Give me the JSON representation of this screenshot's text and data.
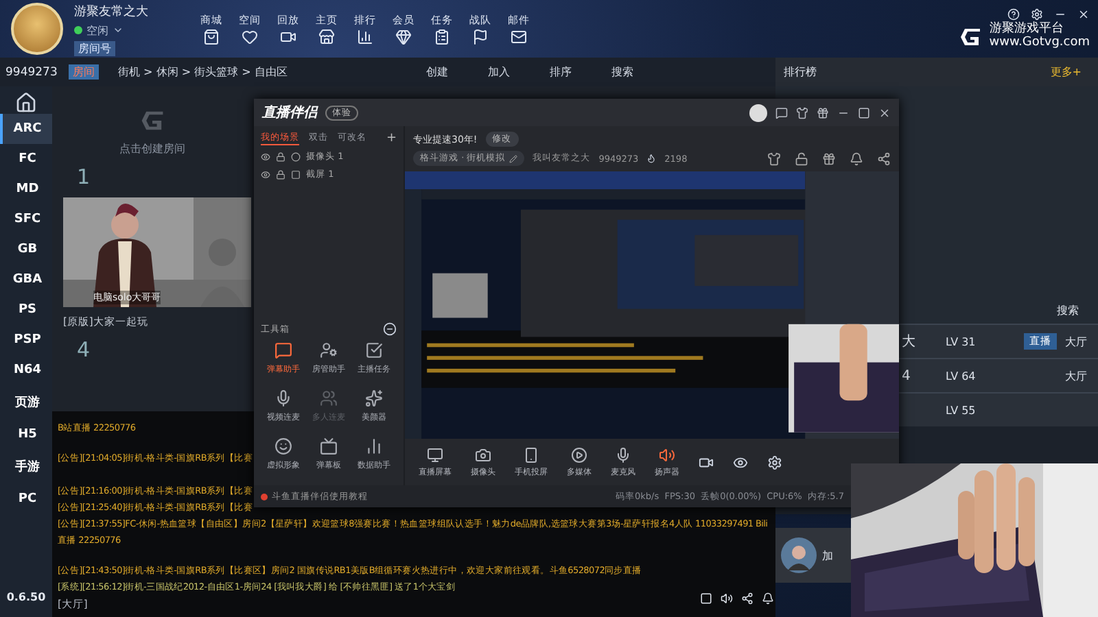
{
  "user": {
    "name": "游聚友常之大",
    "status": "空闲",
    "room_label": "房间号",
    "room_id": "9949273",
    "room_tag": "房间"
  },
  "nav": [
    {
      "label": "商城"
    },
    {
      "label": "空间"
    },
    {
      "label": "回放"
    },
    {
      "label": "主页"
    },
    {
      "label": "排行"
    },
    {
      "label": "会员"
    },
    {
      "label": "任务"
    },
    {
      "label": "战队"
    },
    {
      "label": "邮件"
    }
  ],
  "brand": {
    "name": "游聚游戏平台",
    "url": "www.Gotvg.com"
  },
  "breadcrumb": "街机 > 休闲 > 街头篮球 > 自由区",
  "room_actions": [
    "创建",
    "加入",
    "排序",
    "搜索"
  ],
  "platforms": [
    {
      "label": "ARC",
      "selected": true
    },
    {
      "label": "FC",
      "selected": false
    },
    {
      "label": "MD",
      "selected": false
    },
    {
      "label": "SFC",
      "selected": false
    },
    {
      "label": "GB",
      "selected": false
    },
    {
      "label": "GBA",
      "selected": false
    },
    {
      "label": "PS",
      "selected": false
    },
    {
      "label": "PSP",
      "selected": false
    },
    {
      "label": "N64",
      "selected": false
    },
    {
      "label": "页游",
      "selected": false
    },
    {
      "label": "H5",
      "selected": false
    },
    {
      "label": "手游",
      "selected": false
    },
    {
      "label": "PC",
      "selected": false
    }
  ],
  "version": "0.6.50",
  "rooms": {
    "create_hint": "点击创建房间",
    "first_number": "1",
    "player_caption": "电脑solo大哥哥",
    "room_title": "[原版]大家一起玩",
    "second_number": "4"
  },
  "chat": [
    {
      "kind": "notice",
      "text": "B站直播 22250776"
    },
    {
      "kind": "notice",
      "text": "[公告][21:04:05]街机-格斗类-国旗RB系列【比赛"
    },
    {
      "kind": "notice",
      "text": "[公告][21:16:00]街机-格斗类-国旗RB系列【比赛"
    },
    {
      "kind": "notice",
      "text": "[公告][21:25:40]街机-格斗类-国旗RB系列【比赛"
    },
    {
      "kind": "notice",
      "text": "[公告][21:37:55]FC-休闲-热血篮球【自由区】房间2【星萨轩】欢迎篮球8强赛比赛！热血篮球组队认选手！魅力de品牌队,选篮球大赛第3场-星萨轩报名4人队 11033297491 Bili"
    },
    {
      "kind": "notice",
      "text": "直播 22250776"
    },
    {
      "kind": "notice",
      "text": "[公告][21:43:50]街机-格斗类-国旗RB系列【比赛区】房间2 国旗传说RB1美版B组循环赛火热进行中，欢迎大家前往观看。斗鱼6528072同步直播"
    },
    {
      "kind": "system",
      "text": "[系统][21:56:12]街机-三国战纪2012-自由区1-房间24 [我叫我大爵] 给 [不帅往黑匪] 送了1个大宝剑"
    }
  ],
  "chat_channel": "[大厅]",
  "ranking": {
    "title": "排行榜",
    "more": "更多+",
    "search": "搜索",
    "rows": [
      {
        "name": "大",
        "level": "LV 31",
        "live": "直播",
        "place": "大厅"
      },
      {
        "name": "4",
        "level": "LV 64",
        "place": "大厅"
      },
      {
        "name": "",
        "level": "LV 55",
        "place": ""
      }
    ],
    "partial_name": "加"
  },
  "stream_app": {
    "title": "直播伴侣",
    "title_badge": "体验",
    "scene_tabs": [
      {
        "label": "我的场景",
        "selected": true
      },
      {
        "label": "双击",
        "selected": false
      },
      {
        "label": "可改名",
        "selected": false
      }
    ],
    "add_scene": "+",
    "sources": [
      {
        "label": "摄像头 1"
      },
      {
        "label": "截屏 1"
      }
    ],
    "toolbox_title": "工具箱",
    "tools": [
      {
        "label": "弹幕助手",
        "active": true,
        "disabled": false
      },
      {
        "label": "房管助手",
        "active": false,
        "disabled": false
      },
      {
        "label": "主播任务",
        "active": false,
        "disabled": false
      },
      {
        "label": "视频连麦",
        "active": false,
        "disabled": false
      },
      {
        "label": "多人连麦",
        "active": false,
        "disabled": true
      },
      {
        "label": "美颜器",
        "active": false,
        "disabled": false
      },
      {
        "label": "虚拟形象",
        "active": false,
        "disabled": false
      },
      {
        "label": "弹幕板",
        "active": false,
        "disabled": false
      },
      {
        "label": "数据助手",
        "active": false,
        "disabled": false
      }
    ],
    "tip": "斗鱼直播伴侣使用教程",
    "stream_title": "专业提速30年!",
    "edit": "修改",
    "category": "格斗游戏 · 街机模拟",
    "streamer": "我叫友常之大",
    "room_id": "9949273",
    "hot": "2198",
    "sources_bar": [
      {
        "label": "直播屏幕"
      },
      {
        "label": "摄像头"
      },
      {
        "label": "手机投屏"
      },
      {
        "label": "多媒体"
      },
      {
        "label": "麦克风"
      },
      {
        "label": "扬声器"
      }
    ],
    "stats": "码率0kb/s  FPS:30  丢帧0(0.00%)  CPU:6%  内存:5.7"
  }
}
